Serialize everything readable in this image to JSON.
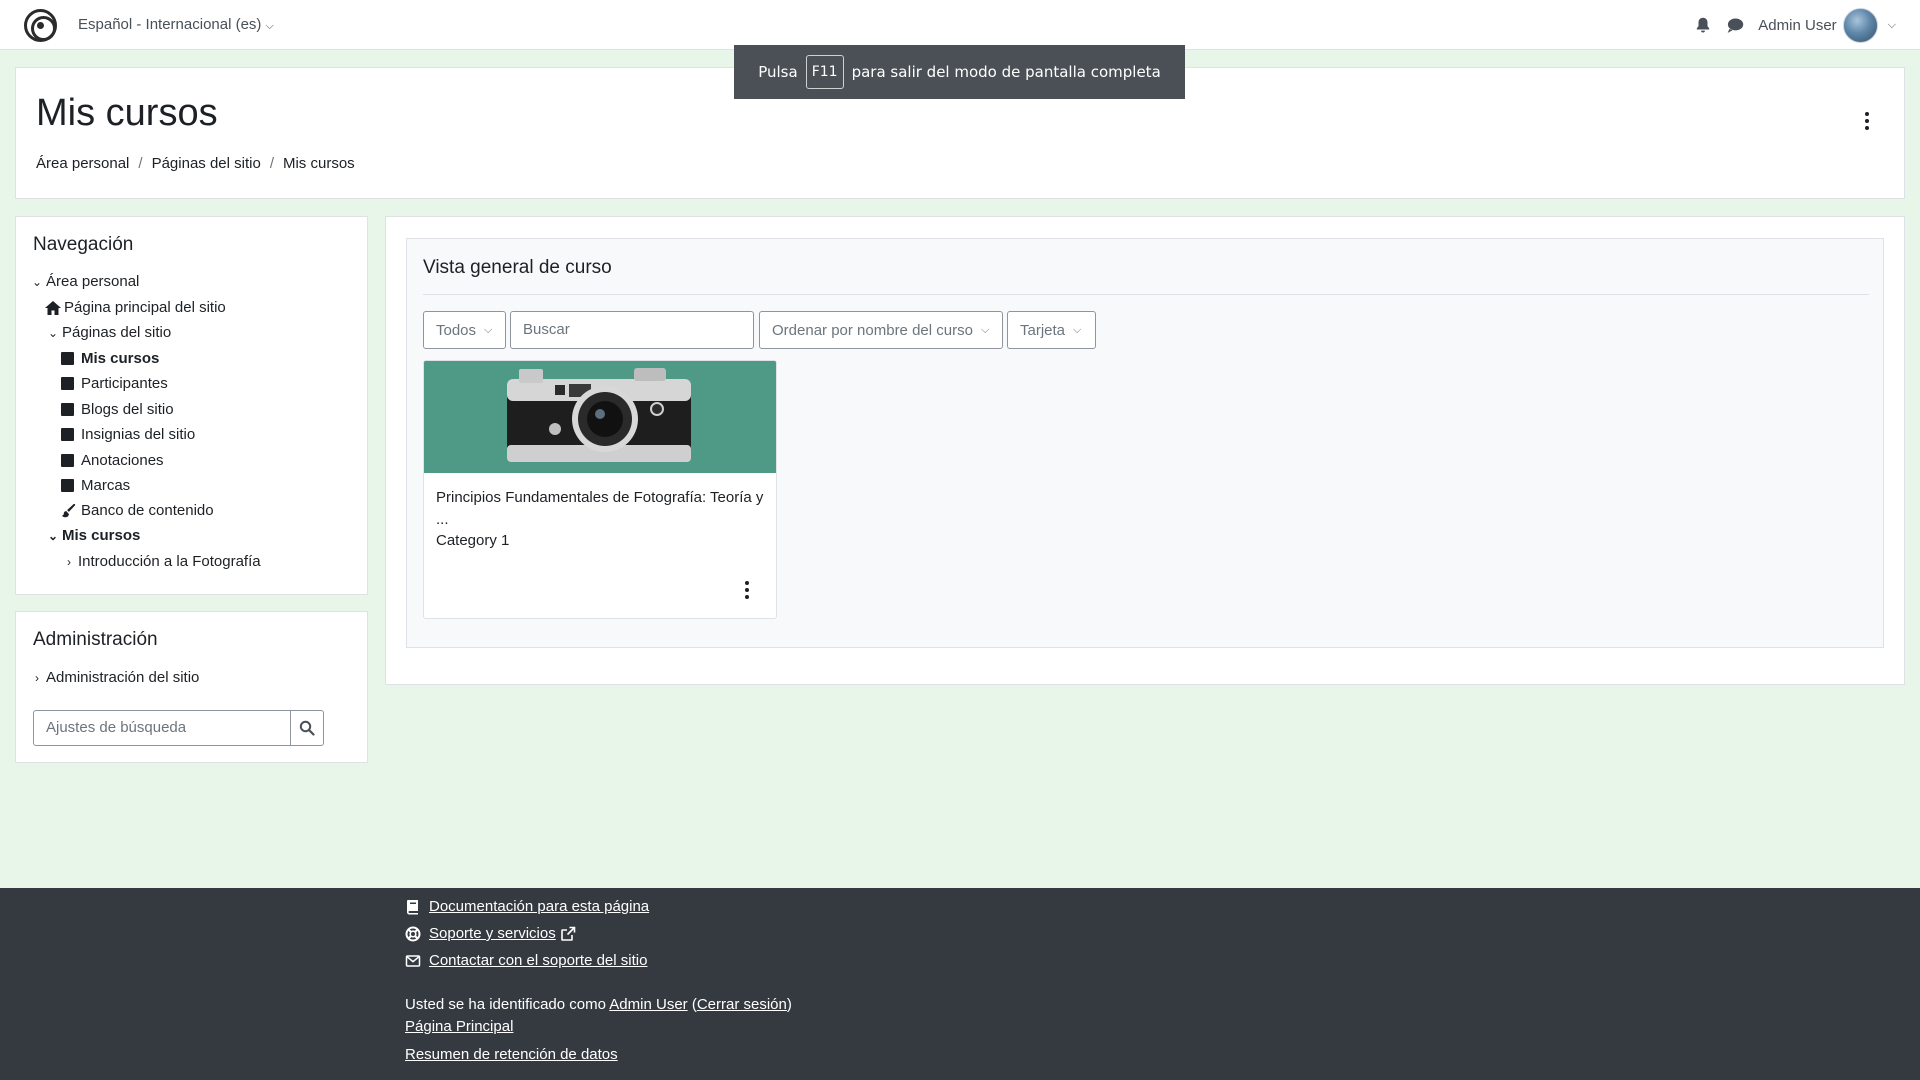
{
  "navbar": {
    "language": "Español - Internacional (es)",
    "username": "Admin User"
  },
  "toast": {
    "before": "Pulsa",
    "key": "F11",
    "after": "para salir del modo de pantalla completa"
  },
  "header": {
    "title": "Mis cursos",
    "breadcrumb": [
      "Área personal",
      "Páginas del sitio",
      "Mis cursos"
    ]
  },
  "navigation": {
    "title": "Navegación",
    "items": [
      "Área personal",
      "Página principal del sitio",
      "Páginas del sitio",
      "Mis cursos",
      "Participantes",
      "Blogs del sitio",
      "Insignias del sitio",
      "Anotaciones",
      "Marcas",
      "Banco de contenido",
      "Mis cursos",
      "Introducción a la Fotografía"
    ]
  },
  "administration": {
    "title": "Administración",
    "site_admin": "Administración del sitio",
    "search_placeholder": "Ajustes de búsqueda"
  },
  "course_overview": {
    "title": "Vista general de curso",
    "filter": "Todos",
    "search_placeholder": "Buscar",
    "sort": "Ordenar por nombre del curso",
    "view": "Tarjeta",
    "courses": [
      {
        "name_line1": "Principios Fundamentales de Fotografía: Teoría y",
        "name_line2": "...",
        "category": "Category 1"
      }
    ]
  },
  "footer": {
    "docs": "Documentación para esta página",
    "support": "Soporte y servicios",
    "contact": "Contactar con el soporte del sitio",
    "logged_prefix": "Usted se ha identificado como",
    "logged_user": "Admin User",
    "logout": "Cerrar sesión",
    "home": "Página Principal",
    "retention": "Resumen de retención de datos"
  },
  "colors": {
    "page_bg": "#e8f5e9",
    "footer_bg": "#343a40",
    "toast_bg": "#4a5055",
    "course_image_bg": "#4f9a87"
  }
}
